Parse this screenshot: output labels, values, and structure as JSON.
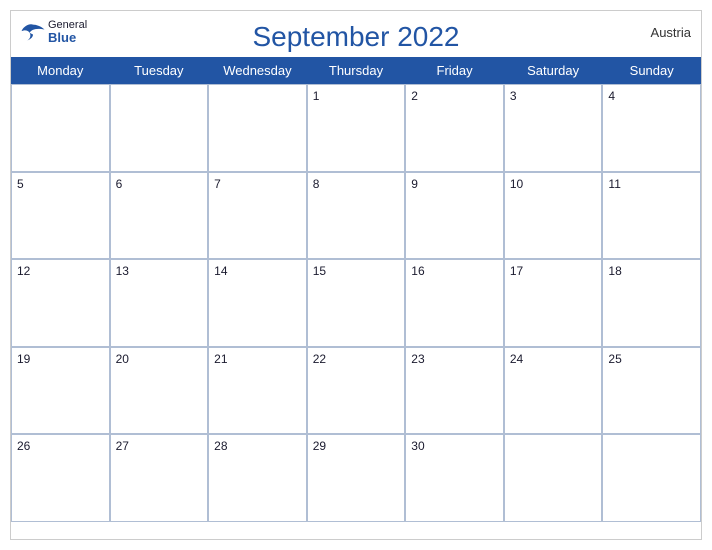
{
  "header": {
    "title": "September 2022",
    "country": "Austria",
    "logo": {
      "general": "General",
      "blue": "Blue"
    }
  },
  "days": {
    "headers": [
      "Monday",
      "Tuesday",
      "Wednesday",
      "Thursday",
      "Friday",
      "Saturday",
      "Sunday"
    ]
  },
  "weeks": [
    [
      "",
      "",
      "",
      "1",
      "2",
      "3",
      "4"
    ],
    [
      "5",
      "6",
      "7",
      "8",
      "9",
      "10",
      "11"
    ],
    [
      "12",
      "13",
      "14",
      "15",
      "16",
      "17",
      "18"
    ],
    [
      "19",
      "20",
      "21",
      "22",
      "23",
      "24",
      "25"
    ],
    [
      "26",
      "27",
      "28",
      "29",
      "30",
      "",
      ""
    ]
  ]
}
